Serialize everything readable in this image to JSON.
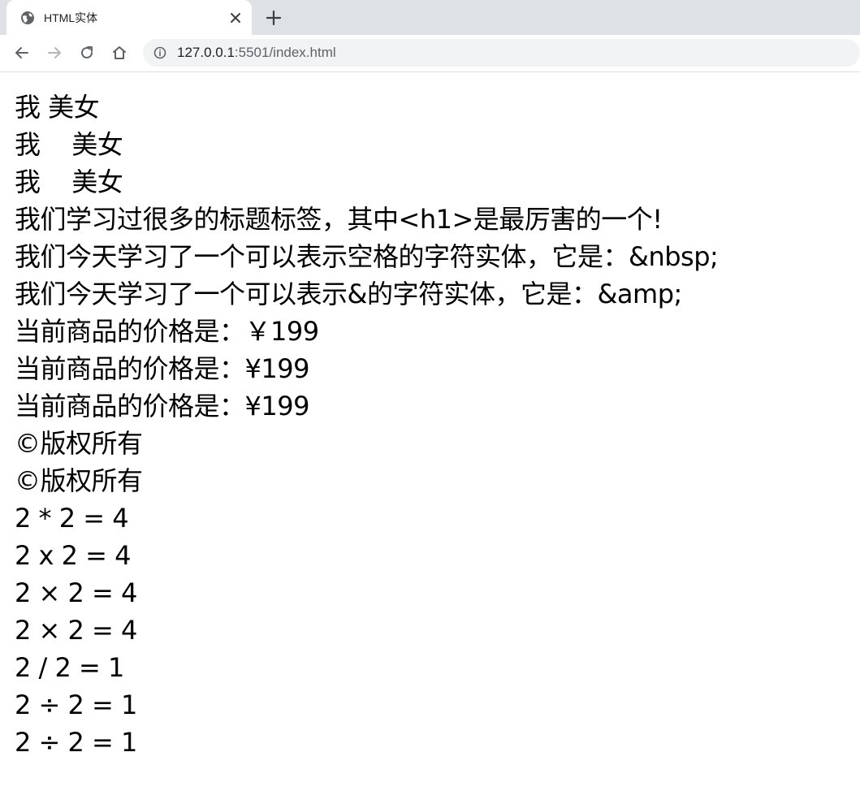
{
  "tab": {
    "title": "HTML实体",
    "favicon": "globe-icon",
    "close": "close-icon"
  },
  "new_tab": "plus-icon",
  "toolbar": {
    "back": "back-arrow-icon",
    "forward": "forward-arrow-icon",
    "reload": "reload-icon",
    "home": "home-icon",
    "site_info": "info-icon",
    "url_host": "127.0.0.1",
    "url_rest": ":5501/index.html"
  },
  "colors": {
    "tabstrip": "#dee1e6",
    "omnibox": "#f1f3f4",
    "icon": "#5f6368",
    "text": "#000000"
  },
  "lines": [
    "我 美女",
    "我    美女",
    "我    美女",
    "我们学习过很多的标题标签，其中<h1>是最厉害的一个!",
    "我们今天学习了一个可以表示空格的字符实体，它是：&nbsp;",
    "我们今天学习了一个可以表示&的字符实体，它是：&amp;",
    "当前商品的价格是：￥199",
    "当前商品的价格是：¥199",
    "当前商品的价格是：¥199",
    "©版权所有",
    "©版权所有",
    "2 * 2 = 4",
    "2 x 2 = 4",
    "2 × 2 = 4",
    "2 × 2 = 4",
    "2 / 2 = 1",
    "2 ÷ 2 = 1",
    "2 ÷ 2 = 1"
  ]
}
